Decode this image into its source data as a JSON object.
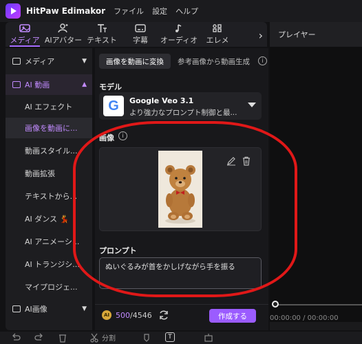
{
  "app": {
    "name": "HitPaw Edimakor",
    "menus": [
      "ファイル",
      "設定",
      "ヘルプ"
    ]
  },
  "toolbar": {
    "tabs": [
      {
        "label": "メディア",
        "icon": "media-icon",
        "active": true
      },
      {
        "label": "AIアバター",
        "icon": "avatar-icon",
        "active": false
      },
      {
        "label": "テキスト",
        "icon": "text-icon",
        "active": false
      },
      {
        "label": "字幕",
        "icon": "subtitle-icon",
        "active": false
      },
      {
        "label": "オーディオ",
        "icon": "audio-icon",
        "active": false
      },
      {
        "label": "エレメ",
        "icon": "elements-icon",
        "active": false
      }
    ],
    "next_icon": "›"
  },
  "player": {
    "title": "プレイヤー",
    "time": "00:00:00 / 00:00:00"
  },
  "sidebar": {
    "items": [
      {
        "label": "メディア",
        "type": "head",
        "caret": "▼"
      },
      {
        "label": "AI 動画",
        "type": "head-active",
        "caret": "▲"
      },
      {
        "label": "AI エフェクト",
        "type": "sub"
      },
      {
        "label": "画像を動画に...",
        "type": "sub-active"
      },
      {
        "label": "動画スタイル...",
        "type": "sub"
      },
      {
        "label": "動画拡張",
        "type": "sub"
      },
      {
        "label": "テキストから...",
        "type": "sub"
      },
      {
        "label": "AI ダンス 💃",
        "type": "sub"
      },
      {
        "label": "AI アニメーシ...",
        "type": "sub"
      },
      {
        "label": "AI トランジシ...",
        "type": "sub"
      },
      {
        "label": "マイプロジェ...",
        "type": "sub"
      },
      {
        "label": "AI画像",
        "type": "head",
        "caret": "▼"
      }
    ]
  },
  "main": {
    "subtabs": [
      "画像を動画に変換",
      "参考画像から動画生成"
    ],
    "info_icon": "i",
    "model_label": "モデル",
    "model": {
      "logo": "G",
      "name": "Google Veo 3.1",
      "desc": "より強力なプロンプト制御と最..."
    },
    "image_label": "画像",
    "image_info_icon": "i",
    "prompt_label": "プロンプト",
    "prompt_text": "ぬいぐるみが首をかしげながら手を振る",
    "credits": {
      "icon": "AI",
      "used": "500",
      "total": "/4546"
    },
    "create_label": "作成する"
  },
  "edit_toolbar": {
    "split_label": "分割",
    "text_icon": "T"
  },
  "colors": {
    "accent": "#9b5cff",
    "annotation": "#e01818"
  }
}
